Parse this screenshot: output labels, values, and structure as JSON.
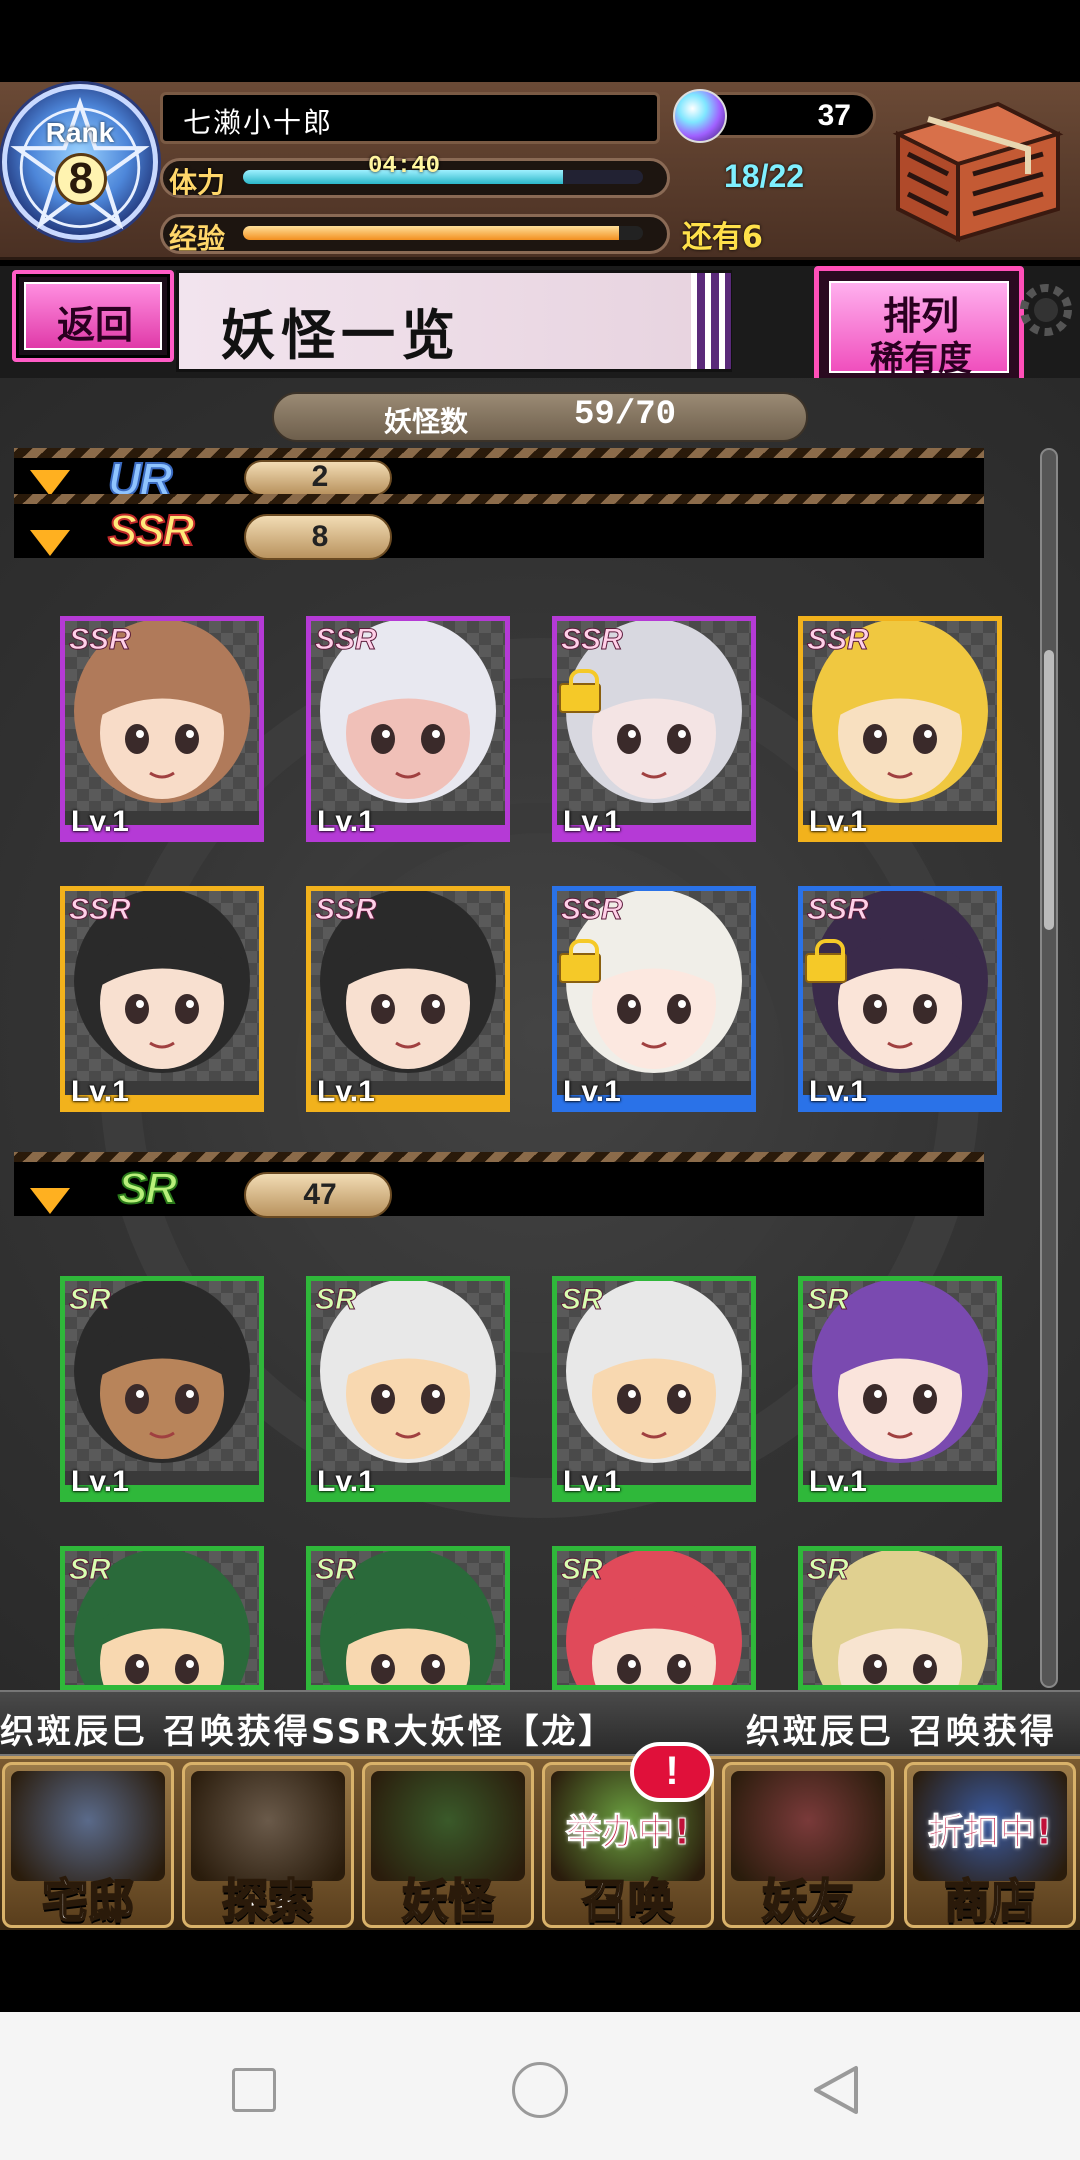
{
  "header": {
    "rank_label": "Rank",
    "rank_value": "8",
    "player_name": "七濑小十郎",
    "stamina_label": "体力",
    "stamina_timer": "04:40",
    "stamina_count": "18/22",
    "stamina_fraction": 0.8,
    "exp_label": "经验",
    "exp_fraction": 0.94,
    "exp_remaining": "还有6",
    "gem_count": "37"
  },
  "titlebar": {
    "back_label": "返回",
    "page_title": "妖怪一览",
    "sort_title": "排列",
    "sort_value": "稀有度"
  },
  "list": {
    "count_label": "妖怪数",
    "count_value": "59/70",
    "categories": [
      {
        "name": "UR",
        "count": "2"
      },
      {
        "name": "SSR",
        "count": "8"
      },
      {
        "name": "SR",
        "count": "47"
      }
    ],
    "level_text": "Lv.1",
    "ssr_cards": [
      {
        "rarity": "SSR",
        "frame": "#b53ad6",
        "locked": false
      },
      {
        "rarity": "SSR",
        "frame": "#b53ad6",
        "locked": false
      },
      {
        "rarity": "SSR",
        "frame": "#b53ad6",
        "locked": true
      },
      {
        "rarity": "SSR",
        "frame": "#f2b21c",
        "locked": false
      },
      {
        "rarity": "SSR",
        "frame": "#f2b21c",
        "locked": false
      },
      {
        "rarity": "SSR",
        "frame": "#f2b21c",
        "locked": false
      },
      {
        "rarity": "SSR",
        "frame": "#2a72e8",
        "locked": true
      },
      {
        "rarity": "SSR",
        "frame": "#2a72e8",
        "locked": true
      }
    ],
    "sr_cards": [
      {
        "rarity": "SR",
        "frame": "#2fb83a"
      },
      {
        "rarity": "SR",
        "frame": "#2fb83a"
      },
      {
        "rarity": "SR",
        "frame": "#2fb83a"
      },
      {
        "rarity": "SR",
        "frame": "#2fb83a"
      },
      {
        "rarity": "SR",
        "frame": "#2fb83a"
      },
      {
        "rarity": "SR",
        "frame": "#2fb83a"
      },
      {
        "rarity": "SR",
        "frame": "#2fb83a"
      },
      {
        "rarity": "SR",
        "frame": "#2fb83a"
      }
    ]
  },
  "ticker": {
    "message": "织斑辰巳  召唤获得SSR大妖怪【龙】",
    "message_repeat": "织斑辰巳  召唤获得"
  },
  "nav": {
    "items": [
      {
        "label": "宅邸",
        "icon": "mansion-icon"
      },
      {
        "label": "探索",
        "icon": "magnifier-icon"
      },
      {
        "label": "妖怪",
        "icon": "scroll-icon"
      },
      {
        "label": "召唤",
        "icon": "summon-star-icon",
        "badge": "举办中!"
      },
      {
        "label": "妖友",
        "icon": "friend-icon"
      },
      {
        "label": "商店",
        "icon": "crystal-orb-icon",
        "badge": "折扣中!"
      }
    ],
    "summon_alert": "!"
  },
  "colors": {
    "ssr_purple": "#b53ad6",
    "ssr_gold": "#f2b21c",
    "ssr_blue": "#2a72e8",
    "sr_green": "#2fb83a",
    "accent_pink": "#ff4fb8"
  }
}
